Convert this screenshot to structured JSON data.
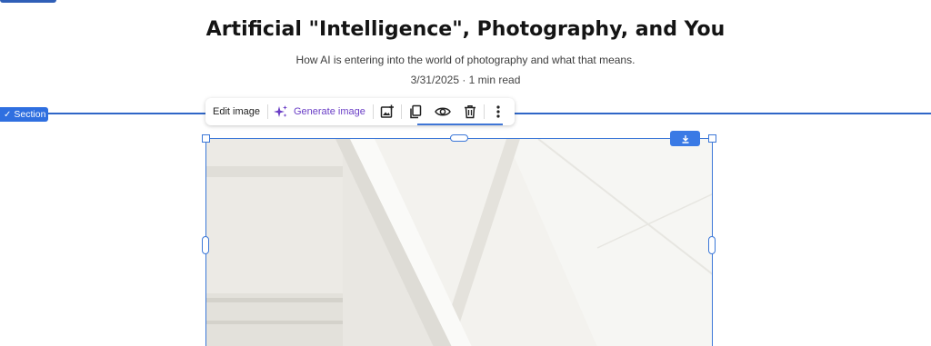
{
  "article": {
    "title": "Artificial \"Intelligence\", Photography, and You",
    "subtitle": "How AI is entering into the world of photography and what that means.",
    "meta": "3/31/2025 · 1 min read"
  },
  "section": {
    "badge_label": "Section"
  },
  "toolbar": {
    "edit_label": "Edit image",
    "generate_label": "Generate image",
    "icons": [
      "image-add-icon",
      "duplicate-icon",
      "eye-icon",
      "trash-icon",
      "more-vertical-icon"
    ]
  },
  "image": {
    "download_icon": "download-icon",
    "alt": "White interior staircase"
  },
  "colors": {
    "accent": "#2f6fe0",
    "generate_purple": "#6a3ec6",
    "selection_blue": "#3c78d8"
  }
}
